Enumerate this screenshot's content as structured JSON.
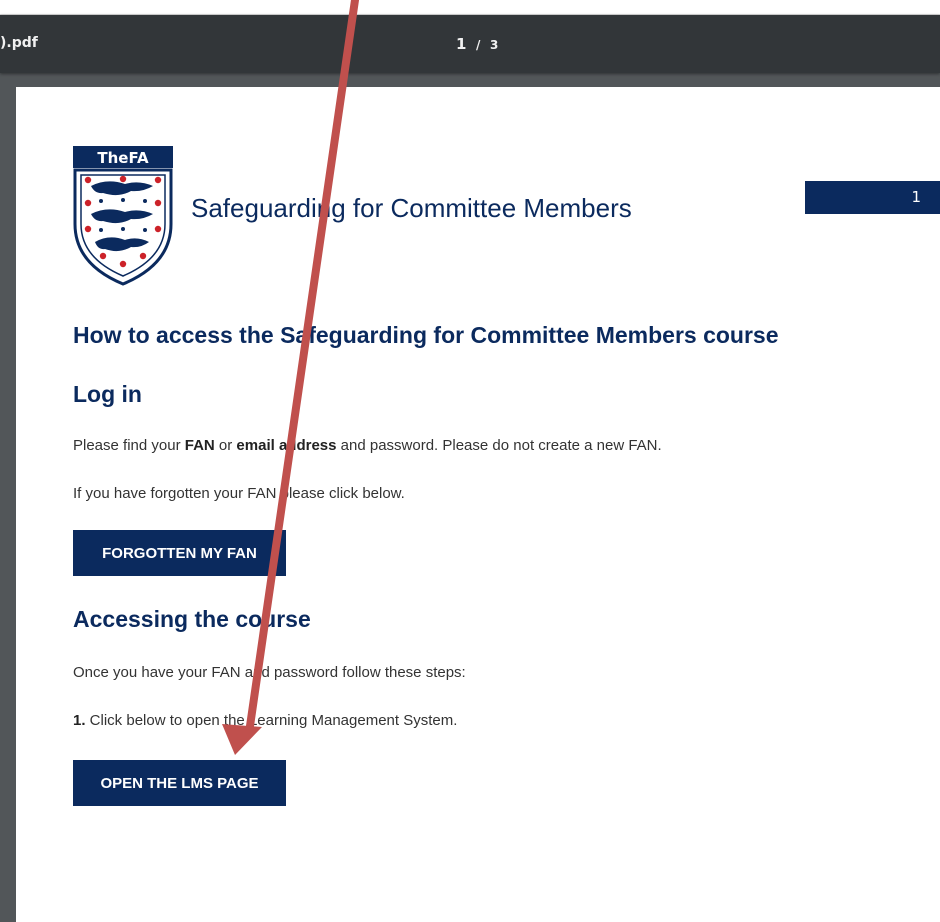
{
  "toolbar": {
    "filename": ").pdf",
    "current_page": "1",
    "separator": "/",
    "total_pages": "3"
  },
  "crest": {
    "logo_text": "TheFA",
    "primary_color": "#0b2a5e",
    "accent_color": "#cc2229"
  },
  "document": {
    "title": "Safeguarding for Committee Members",
    "page_box_number": "1",
    "heading": "How to access the Safeguarding for Committee Members course",
    "login": {
      "heading": "Log in",
      "para1_pre": "Please find your ",
      "para1_fan": "FAN",
      "para1_mid": " or ",
      "para1_email": "email address",
      "para1_post": " and password. Please do not create a new FAN.",
      "para2": "If you have forgotten your FAN please click below.",
      "button": "FORGOTTEN MY FAN"
    },
    "course": {
      "heading": "Accessing the course",
      "para1": "Once you have your FAN and password follow these steps:",
      "step_number": "1.",
      "step_text": " Click below to open the Learning Management System.",
      "button": "OPEN THE LMS PAGE"
    }
  },
  "annotation": {
    "arrow_color": "#c0504d",
    "arrow_icon": "red-arrow-icon"
  }
}
